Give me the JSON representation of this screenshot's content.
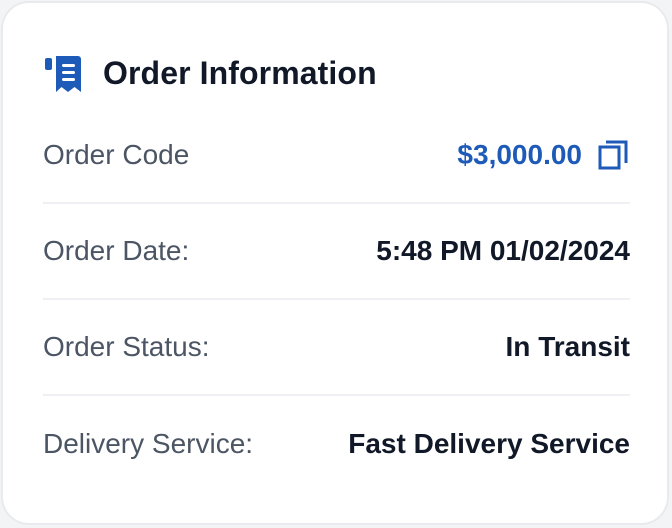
{
  "colors": {
    "accent": "#1e5bb8",
    "title": "#111827",
    "label": "#4b5563",
    "divider": "#eef0f3"
  },
  "card": {
    "title": "Order Information",
    "title_icon": "receipt-icon"
  },
  "rows": [
    {
      "label": "Order Code",
      "value": "$3,000.00",
      "action_icon": "copy-icon"
    },
    {
      "label": "Order Date:",
      "value": "5:48 PM 01/02/2024"
    },
    {
      "label": "Order Status:",
      "value": "In Transit"
    },
    {
      "label": "Delivery Service:",
      "value": "Fast Delivery Service"
    }
  ]
}
